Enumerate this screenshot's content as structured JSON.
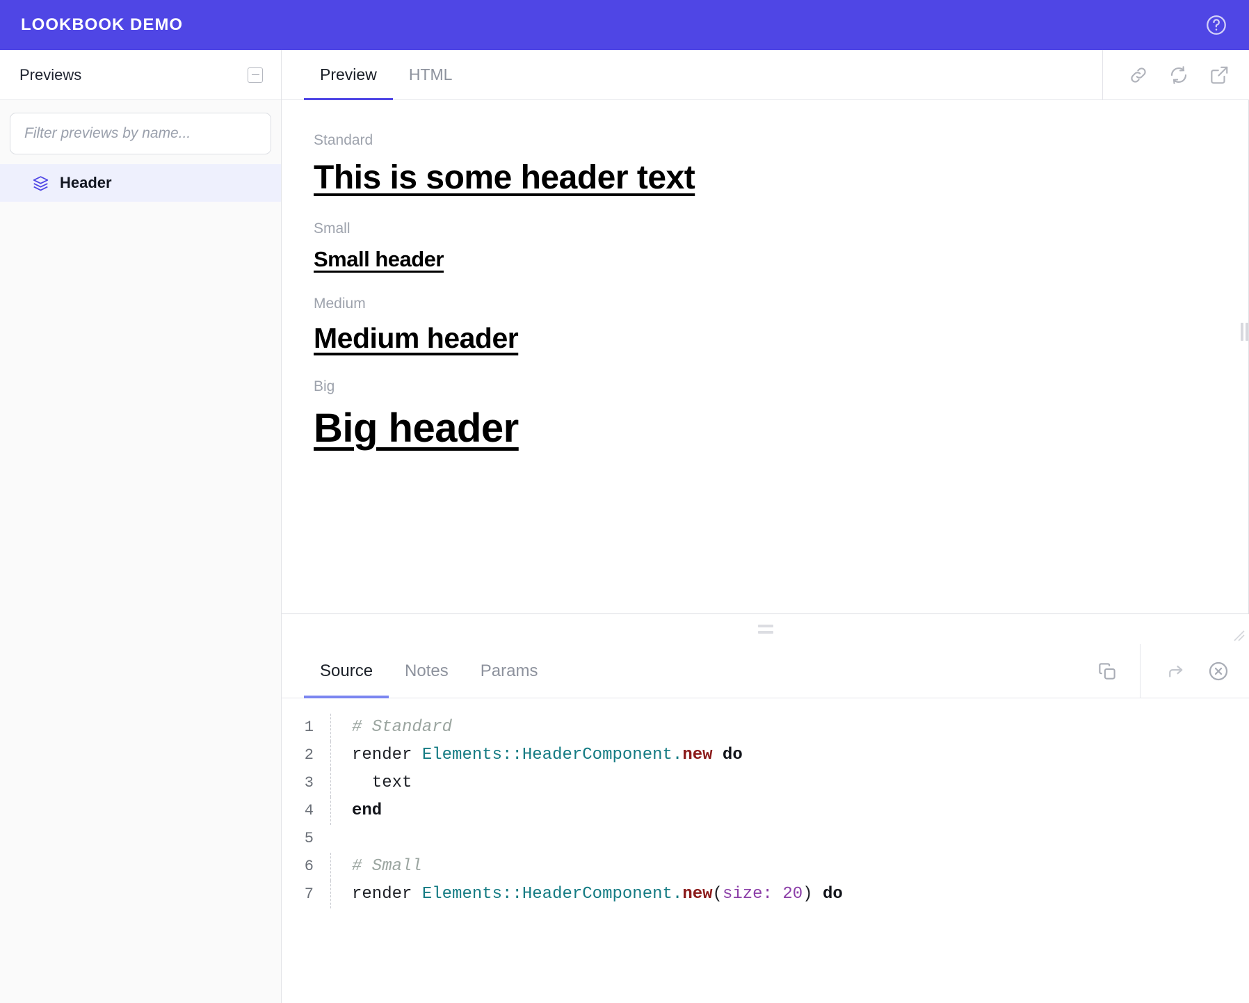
{
  "navbar": {
    "brand": "LOOKBOOK DEMO",
    "help_icon": "question-circle-icon"
  },
  "sidebar": {
    "title": "Previews",
    "collapse_icon": "collapse-minus-icon",
    "filter": {
      "placeholder": "Filter previews by name...",
      "value": ""
    },
    "items": [
      {
        "label": "Header",
        "icon": "layers-icon",
        "selected": true
      }
    ]
  },
  "preview_panel": {
    "tabs": [
      {
        "label": "Preview",
        "active": true
      },
      {
        "label": "HTML",
        "active": false
      }
    ],
    "actions": [
      {
        "name": "copy-link-icon"
      },
      {
        "name": "refresh-icon"
      },
      {
        "name": "open-external-icon"
      }
    ],
    "samples": [
      {
        "label": "Standard",
        "header": "This is some header text",
        "size_class": "h-standard"
      },
      {
        "label": "Small",
        "header": "Small header",
        "size_class": "h-small"
      },
      {
        "label": "Medium",
        "header": "Medium header",
        "size_class": "h-medium"
      },
      {
        "label": "Big",
        "header": "Big header",
        "size_class": "h-big"
      }
    ]
  },
  "source_panel": {
    "tabs": [
      {
        "label": "Source",
        "active": true
      },
      {
        "label": "Notes",
        "active": false
      },
      {
        "label": "Params",
        "active": false
      }
    ],
    "copy_icon": "copy-icon",
    "share_icon": "arrow-forward-icon",
    "close_icon": "close-circle-icon",
    "code": [
      {
        "num": "1",
        "tokens": [
          {
            "t": "# Standard",
            "c": "tok-comment"
          }
        ]
      },
      {
        "num": "2",
        "tokens": [
          {
            "t": "render ",
            "c": "tok-plain"
          },
          {
            "t": "Elements",
            "c": "tok-const"
          },
          {
            "t": "::",
            "c": "tok-punct"
          },
          {
            "t": "HeaderComponent",
            "c": "tok-const"
          },
          {
            "t": ".",
            "c": "tok-punct"
          },
          {
            "t": "new",
            "c": "tok-method"
          },
          {
            "t": " do",
            "c": "tok-kw"
          }
        ]
      },
      {
        "num": "3",
        "tokens": [
          {
            "t": "  text",
            "c": "tok-plain"
          }
        ]
      },
      {
        "num": "4",
        "tokens": [
          {
            "t": "end",
            "c": "tok-kw"
          }
        ]
      },
      {
        "num": "5",
        "tokens": [
          {
            "t": "",
            "c": "tok-plain"
          }
        ]
      },
      {
        "num": "6",
        "tokens": [
          {
            "t": "# Small",
            "c": "tok-comment"
          }
        ]
      },
      {
        "num": "7",
        "tokens": [
          {
            "t": "render ",
            "c": "tok-plain"
          },
          {
            "t": "Elements",
            "c": "tok-const"
          },
          {
            "t": "::",
            "c": "tok-punct"
          },
          {
            "t": "HeaderComponent",
            "c": "tok-const"
          },
          {
            "t": ".",
            "c": "tok-punct"
          },
          {
            "t": "new",
            "c": "tok-method"
          },
          {
            "t": "(",
            "c": "tok-plain"
          },
          {
            "t": "size:",
            "c": "tok-sym"
          },
          {
            "t": " ",
            "c": "tok-plain"
          },
          {
            "t": "20",
            "c": "tok-num"
          },
          {
            "t": ")",
            "c": "tok-plain"
          },
          {
            "t": " do",
            "c": "tok-kw"
          }
        ]
      }
    ]
  },
  "splitters": {
    "horizontal_grip": "horizontal-resize-grip",
    "vertical_grip": "vertical-resize-grip",
    "corner_grip": "corner-resize-grip"
  },
  "colors": {
    "brand": "#4f46e5",
    "accent": "#7b86f0",
    "selected_row": "#eef0fd"
  }
}
